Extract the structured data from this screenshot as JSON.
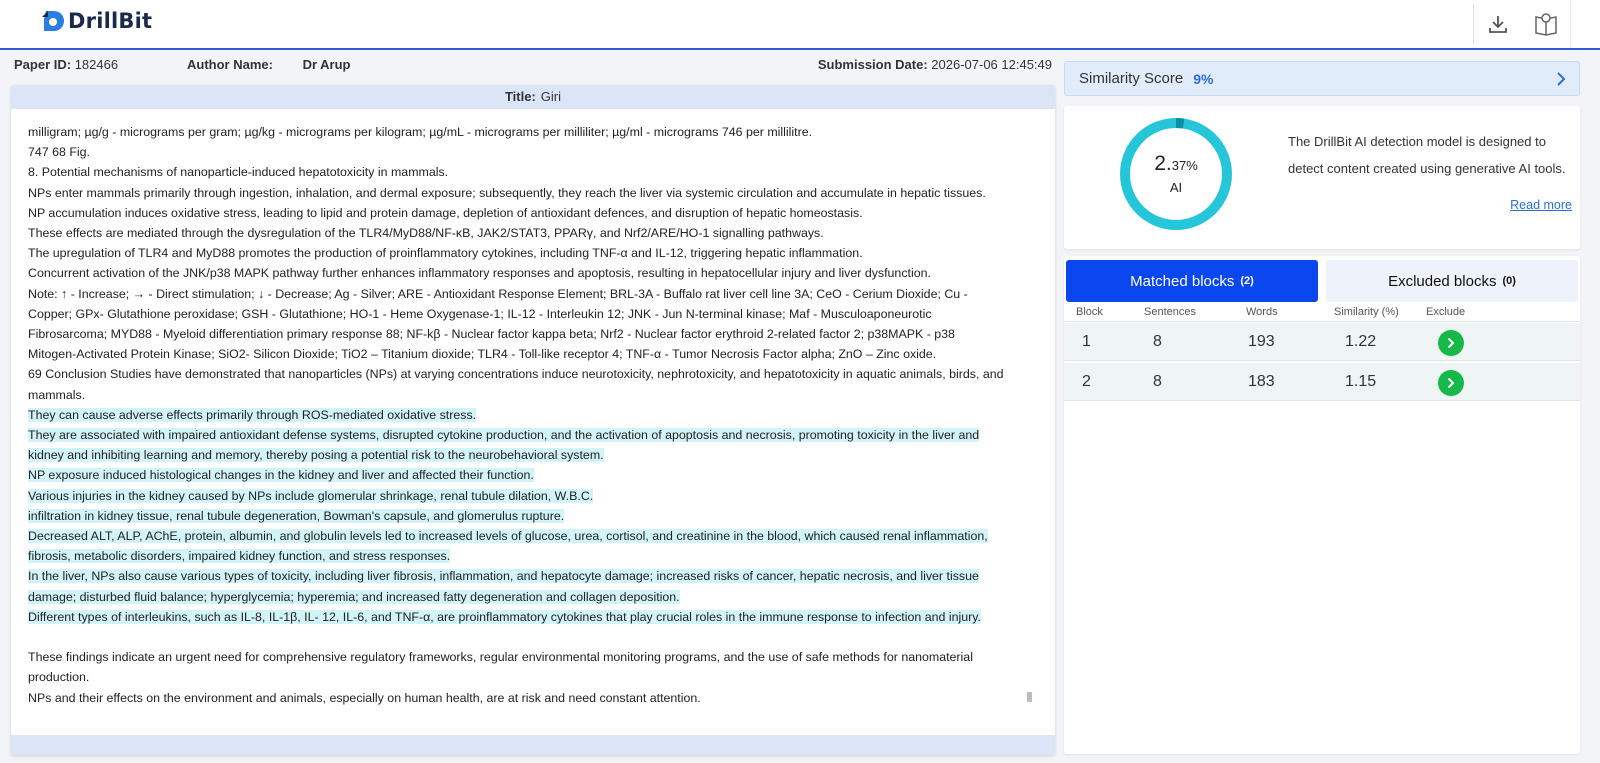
{
  "app": {
    "name": "DrillBit"
  },
  "meta": {
    "paper_id_label": "Paper ID:",
    "paper_id": "182466",
    "author_label": "Author Name:",
    "author": "Dr Arup",
    "submission_label": "Submission Date:",
    "submission_date": "2026-07-06 12:45:49"
  },
  "document": {
    "title_label": "Title:",
    "title": "Giri",
    "lines": [
      {
        "text": "milligram; µg/g - micrograms per gram; µg/kg - micrograms per kilogram; µg/mL - micrograms per milliliter; µg/ml - micrograms 746 per millilitre.",
        "hl": false
      },
      {
        "text": "747 68 Fig.",
        "hl": false
      },
      {
        "text": "8. Potential mechanisms of nanoparticle-induced hepatotoxicity in mammals.",
        "hl": false
      },
      {
        "text": "NPs enter mammals primarily through ingestion, inhalation, and dermal exposure; subsequently, they reach the liver via systemic circulation and accumulate in hepatic tissues.",
        "hl": false
      },
      {
        "text": "NP accumulation induces oxidative stress, leading to lipid and protein damage, depletion of antioxidant defences, and disruption of hepatic homeostasis.",
        "hl": false
      },
      {
        "text": "These effects are mediated through the dysregulation of the TLR4/MyD88/NF-κB, JAK2/STAT3, PPARγ, and Nrf2/ARE/HO-1 signalling pathways.",
        "hl": false
      },
      {
        "text": "The upregulation of TLR4 and MyD88 promotes the production of proinflammatory cytokines, including TNF-α and IL-12, triggering hepatic inflammation.",
        "hl": false
      },
      {
        "text": "Concurrent activation of the JNK/p38 MAPK pathway further enhances inflammatory responses and apoptosis, resulting in hepatocellular injury and liver dysfunction.",
        "hl": false
      },
      {
        "text": "Note: ↑ - Increase; → - Direct stimulation; ↓ - Decrease; Ag - Silver; ARE - Antioxidant Response Element; BRL-3A - Buffalo rat liver cell line 3A; CeO - Cerium Dioxide; Cu -",
        "hl": false
      },
      {
        "text": "Copper; GPx- Glutathione peroxidase; GSH - Glutathione; HO-1 - Heme Oxygenase-1; IL-12 - Interleukin 12; JNK - Jun N-terminal kinase; Maf - Musculoaponeurotic",
        "hl": false
      },
      {
        "text": "Fibrosarcoma; MYD88 - Myeloid differentiation primary response 88; NF-kβ - Nuclear factor kappa beta; Nrf2 - Nuclear factor erythroid 2-related factor 2; p38MAPK - p38",
        "hl": false
      },
      {
        "text": "Mitogen-Activated Protein Kinase; SiO2- Silicon Dioxide; TiO2 – Titanium dioxide; TLR4 - Toll-like receptor 4; TNF-α - Tumor Necrosis Factor alpha; ZnO – Zinc oxide.",
        "hl": false
      },
      {
        "text": "69 Conclusion Studies have demonstrated that nanoparticles (NPs) at varying concentrations induce neurotoxicity, nephrotoxicity, and hepatotoxicity in aquatic animals, birds, and",
        "hl": false
      },
      {
        "text": "mammals.",
        "hl": false
      },
      {
        "text": "They can cause adverse effects primarily through ROS-mediated oxidative stress.",
        "hl": true
      },
      {
        "text": "They are associated with impaired antioxidant defense systems, disrupted cytokine production, and the activation of apoptosis and necrosis, promoting toxicity in the liver and",
        "hl": true
      },
      {
        "text": "kidney and inhibiting learning and memory, thereby posing a potential risk to the neurobehavioral system.",
        "hl": true
      },
      {
        "text": "NP exposure induced histological changes in the kidney and liver and affected their function.",
        "hl": true
      },
      {
        "text": "Various injuries in the kidney caused by NPs include glomerular shrinkage, renal tubule dilation, W.B.C.",
        "hl": true
      },
      {
        "text": "infiltration in kidney tissue, renal tubule degeneration, Bowman's capsule, and glomerulus rupture.",
        "hl": true
      },
      {
        "text": "Decreased ALT, ALP, AChE, protein, albumin, and globulin levels led to increased levels of glucose, urea, cortisol, and creatinine in the blood, which caused renal inflammation,",
        "hl": true
      },
      {
        "text": "fibrosis, metabolic disorders, impaired kidney function, and stress responses.",
        "hl": true
      },
      {
        "text": "In the liver, NPs also cause various types of toxicity, including liver fibrosis, inflammation, and hepatocyte damage; increased risks of cancer, hepatic necrosis, and liver tissue",
        "hl": true
      },
      {
        "text": "damage; disturbed fluid balance; hyperglycemia; hyperemia; and increased fatty degeneration and collagen deposition.",
        "hl": true
      },
      {
        "text": "Different types of interleukins, such as IL-8, IL-1β, IL- 12, IL-6, and TNF-α, are proinflammatory cytokines that play crucial roles in the immune response to infection and injury.",
        "hl": true
      },
      {
        "text": "",
        "hl": false
      },
      {
        "text": "These findings indicate an urgent need for comprehensive regulatory frameworks, regular environmental monitoring programs, and the use of safe methods for nanomaterial",
        "hl": false
      },
      {
        "text": "production.",
        "hl": false
      },
      {
        "text": "NPs and their effects on the environment and animals, especially on human health, are at risk and need constant attention.",
        "hl": false
      }
    ]
  },
  "similarity": {
    "label": "Similarity Score",
    "value": "9%"
  },
  "ai": {
    "percent_int": "2.",
    "percent_dec": "37%",
    "tag": "AI",
    "ratio": 0.0237,
    "description": "The DrillBit AI detection model is designed to detect content created using generative AI tools.",
    "read_more": "Read more",
    "ring_color": "#26c6da"
  },
  "blocks": {
    "matched_label": "Matched blocks",
    "matched_count": "(2)",
    "excluded_label": "Excluded blocks",
    "excluded_count": "(0)",
    "columns": [
      "Block",
      "Sentences",
      "Words",
      "Similarity (%)",
      "Exclude"
    ],
    "rows": [
      {
        "block": "1",
        "sentences": "8",
        "words": "193",
        "similarity": "1.22"
      },
      {
        "block": "2",
        "sentences": "8",
        "words": "183",
        "similarity": "1.15"
      }
    ]
  },
  "colors": {
    "accent": "#0a47ef",
    "highlight": "#d2f3f8",
    "exclude_green": "#17b84a"
  }
}
